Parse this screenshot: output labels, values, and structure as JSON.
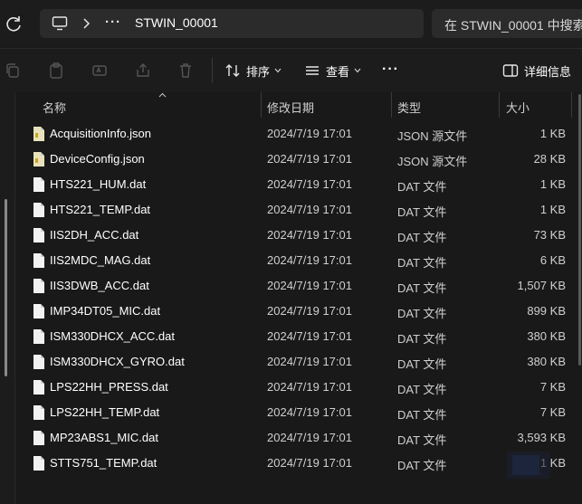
{
  "address": {
    "breadcrumb": "STWIN_00001",
    "search_placeholder": "在 STWIN_00001 中搜索"
  },
  "toolbar": {
    "sort_label": "排序",
    "view_label": "查看",
    "details_label": "详细信息"
  },
  "columns": {
    "name": "名称",
    "date": "修改日期",
    "type": "类型",
    "size": "大小"
  },
  "files": [
    {
      "name": "AcquisitionInfo.json",
      "date": "2024/7/19 17:01",
      "type": "JSON 源文件",
      "size": "1 KB",
      "icon": "json-file-icon"
    },
    {
      "name": "DeviceConfig.json",
      "date": "2024/7/19 17:01",
      "type": "JSON 源文件",
      "size": "28 KB",
      "icon": "json-file-icon"
    },
    {
      "name": "HTS221_HUM.dat",
      "date": "2024/7/19 17:01",
      "type": "DAT 文件",
      "size": "1 KB",
      "icon": "file-icon"
    },
    {
      "name": "HTS221_TEMP.dat",
      "date": "2024/7/19 17:01",
      "type": "DAT 文件",
      "size": "1 KB",
      "icon": "file-icon"
    },
    {
      "name": "IIS2DH_ACC.dat",
      "date": "2024/7/19 17:01",
      "type": "DAT 文件",
      "size": "73 KB",
      "icon": "file-icon"
    },
    {
      "name": "IIS2MDC_MAG.dat",
      "date": "2024/7/19 17:01",
      "type": "DAT 文件",
      "size": "6 KB",
      "icon": "file-icon"
    },
    {
      "name": "IIS3DWB_ACC.dat",
      "date": "2024/7/19 17:01",
      "type": "DAT 文件",
      "size": "1,507 KB",
      "icon": "file-icon"
    },
    {
      "name": "IMP34DT05_MIC.dat",
      "date": "2024/7/19 17:01",
      "type": "DAT 文件",
      "size": "899 KB",
      "icon": "file-icon"
    },
    {
      "name": "ISM330DHCX_ACC.dat",
      "date": "2024/7/19 17:01",
      "type": "DAT 文件",
      "size": "380 KB",
      "icon": "file-icon"
    },
    {
      "name": "ISM330DHCX_GYRO.dat",
      "date": "2024/7/19 17:01",
      "type": "DAT 文件",
      "size": "380 KB",
      "icon": "file-icon"
    },
    {
      "name": "LPS22HH_PRESS.dat",
      "date": "2024/7/19 17:01",
      "type": "DAT 文件",
      "size": "7 KB",
      "icon": "file-icon"
    },
    {
      "name": "LPS22HH_TEMP.dat",
      "date": "2024/7/19 17:01",
      "type": "DAT 文件",
      "size": "7 KB",
      "icon": "file-icon"
    },
    {
      "name": "MP23ABS1_MIC.dat",
      "date": "2024/7/19 17:01",
      "type": "DAT 文件",
      "size": "3,593 KB",
      "icon": "file-icon"
    },
    {
      "name": "STTS751_TEMP.dat",
      "date": "2024/7/19 17:01",
      "type": "DAT 文件",
      "size": "1 KB",
      "icon": "file-icon"
    }
  ],
  "colors": {
    "background": "#191919",
    "bar": "#1c1c1c",
    "field": "#2b2b2b",
    "text": "#ffffff",
    "muted": "#cfcfcf"
  }
}
